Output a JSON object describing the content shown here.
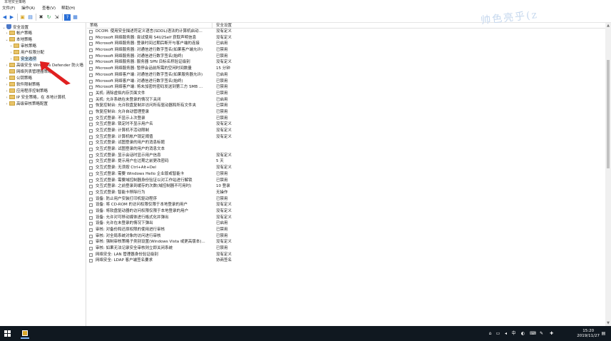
{
  "window": {
    "title": "本地安全策略"
  },
  "menu": [
    "文件(F)",
    "操作(A)",
    "查看(V)",
    "帮助(H)"
  ],
  "toolbar": [
    {
      "icon": "back-arrow-icon",
      "glyph": "◀"
    },
    {
      "icon": "forward-arrow-icon",
      "glyph": "▶"
    },
    {
      "icon": "up-folder-icon",
      "glyph": "▣"
    },
    {
      "icon": "show-hide-tree-icon",
      "glyph": "▤"
    },
    {
      "icon": "delete-icon",
      "glyph": "✖"
    },
    {
      "icon": "refresh-icon",
      "glyph": "↻"
    },
    {
      "icon": "export-list-icon",
      "glyph": "⇲"
    },
    {
      "icon": "help-icon",
      "glyph": "?"
    },
    {
      "icon": "properties-icon",
      "glyph": "▦"
    }
  ],
  "tree": [
    {
      "label": "安全设置",
      "level": 0,
      "toggle": "v",
      "icon": "shield"
    },
    {
      "label": "帐户策略",
      "level": 1,
      "toggle": ">",
      "icon": "folder"
    },
    {
      "label": "本地策略",
      "level": 1,
      "toggle": "v",
      "icon": "folder"
    },
    {
      "label": "审核策略",
      "level": 2,
      "toggle": ">",
      "icon": "folder"
    },
    {
      "label": "用户权限分配",
      "level": 2,
      "toggle": ">",
      "icon": "folder"
    },
    {
      "label": "安全选项",
      "level": 2,
      "toggle": ">",
      "icon": "folder",
      "selected": true
    },
    {
      "label": "高级安全 Windows Defender 防火墙",
      "level": 1,
      "toggle": ">",
      "icon": "folder"
    },
    {
      "label": "网络列表管理器策略",
      "level": 1,
      "toggle": "",
      "icon": "folder"
    },
    {
      "label": "公钥策略",
      "level": 1,
      "toggle": ">",
      "icon": "folder"
    },
    {
      "label": "软件限制策略",
      "level": 1,
      "toggle": ">",
      "icon": "folder"
    },
    {
      "label": "应用程序控制策略",
      "level": 1,
      "toggle": ">",
      "icon": "folder"
    },
    {
      "label": "IP 安全策略，在 本地计算机",
      "level": 1,
      "toggle": ">",
      "icon": "folder"
    },
    {
      "label": "高级审核策略配置",
      "level": 1,
      "toggle": ">",
      "icon": "folder"
    }
  ],
  "columns": {
    "policy": "策略",
    "setting": "安全设置"
  },
  "rows": [
    {
      "policy": "DCOM: 使用安全描述符定义语言(SDDL)语法的计算机启动...",
      "setting": "没有定义"
    },
    {
      "policy": "Microsoft 网络服务器: 尝试使用 S4U2Self 获取声明信息",
      "setting": "没有定义"
    },
    {
      "policy": "Microsoft 网络服务器: 登录时间过期后断开与客户端的连接",
      "setting": "已启用"
    },
    {
      "policy": "Microsoft 网络服务器: 对通信进行数字签名(如果客户端允许)",
      "setting": "已禁用"
    },
    {
      "policy": "Microsoft 网络服务器: 对通信进行数字签名(始终)",
      "setting": "已禁用"
    },
    {
      "policy": "Microsoft 网络服务器: 服务器 SPN 目标名称验证级别",
      "setting": "没有定义"
    },
    {
      "policy": "Microsoft 网络服务器: 暂停会话前所需的空闲时间数量",
      "setting": "15 分钟"
    },
    {
      "policy": "Microsoft 网络客户端: 对通信进行数字签名(如果服务器允许)",
      "setting": "已启用"
    },
    {
      "policy": "Microsoft 网络客户端: 对通信进行数字签名(始终)",
      "setting": "已禁用"
    },
    {
      "policy": "Microsoft 网络客户端: 将未加密的密码发送到第三方 SMB ...",
      "setting": "已禁用"
    },
    {
      "policy": "关机: 清除虚拟内存页面文件",
      "setting": "已禁用"
    },
    {
      "policy": "关机: 允许系统在未登录的情况下关闭",
      "setting": "已启用"
    },
    {
      "policy": "恢复控制台: 允许软盘复制并访问所有驱动器和所有文件夹",
      "setting": "已禁用"
    },
    {
      "policy": "恢复控制台: 允许自动管理登录",
      "setting": "已禁用"
    },
    {
      "policy": "交互式登录: 不显示上次登录",
      "setting": "已禁用"
    },
    {
      "policy": "交互式登录: 锁定时不显示用户名",
      "setting": "没有定义"
    },
    {
      "policy": "交互式登录: 计算机不活动限制",
      "setting": "没有定义"
    },
    {
      "policy": "交互式登录: 计算机帐户锁定阈值",
      "setting": "没有定义"
    },
    {
      "policy": "交互式登录: 试图登录的用户的消息标题",
      "setting": ""
    },
    {
      "policy": "交互式登录: 试图登录的用户的消息文本",
      "setting": ""
    },
    {
      "policy": "交互式登录: 显示会话时显示用户信息",
      "setting": "没有定义"
    },
    {
      "policy": "交互式登录: 提示用户在过期之前更改密码",
      "setting": "5 天"
    },
    {
      "policy": "交互式登录: 无须按 Ctrl+Alt+Del",
      "setting": "没有定义"
    },
    {
      "policy": "交互式登录: 需要 Windows Hello 企业版或智能卡",
      "setting": "已禁用"
    },
    {
      "policy": "交互式登录: 需要域控制器身份验证以对工作站进行解锁",
      "setting": "已禁用"
    },
    {
      "policy": "交互式登录: 之前登录到缓存的次数(域控制器不可用时)",
      "setting": "10 登录"
    },
    {
      "policy": "交互式登录: 智能卡移除行为",
      "setting": "无操作"
    },
    {
      "policy": "设备: 防止用户安装打印机驱动程序",
      "setting": "已禁用"
    },
    {
      "policy": "设备: 将 CD-ROM 的访问权限仅限于本地登录的用户",
      "setting": "没有定义"
    },
    {
      "policy": "设备: 将软盘驱动器的访问权限仅限于本地登录的用户",
      "setting": "没有定义"
    },
    {
      "policy": "设备: 允许对可移动媒体进行格式化并弹出",
      "setting": "没有定义"
    },
    {
      "policy": "设备: 允许在未登录的情况下弹出",
      "setting": "已启用"
    },
    {
      "policy": "审核: 对备份和还原权限的使用进行审核",
      "setting": "已禁用"
    },
    {
      "policy": "审核: 对全局系统对象的访问进行审核",
      "setting": "已禁用"
    },
    {
      "policy": "审核: 强制审核策略子类别设置(Windows Vista 或更高版本)...",
      "setting": "没有定义"
    },
    {
      "policy": "审核: 如果无法记录安全审核则立即关闭系统",
      "setting": "已禁用"
    },
    {
      "policy": "网络安全: LAN 管理器身份验证级别",
      "setting": "没有定义"
    },
    {
      "policy": "网络安全: LDAP 客户端签名要求",
      "setting": "协商签名"
    }
  ],
  "taskbar": {
    "clock_time": "15:20",
    "clock_date": "2019/11/27",
    "tray_icons": [
      "network-icon",
      "battery-icon",
      "volume-icon",
      "ime-icon",
      "language-icon",
      "keyboard-icon",
      "input-icon",
      "notification-icon"
    ]
  },
  "watermark": "帅色亮乎(z",
  "colors": {
    "selection": "#cce4f7",
    "taskbar": "#101820",
    "annotation_arrow": "#e02020"
  }
}
